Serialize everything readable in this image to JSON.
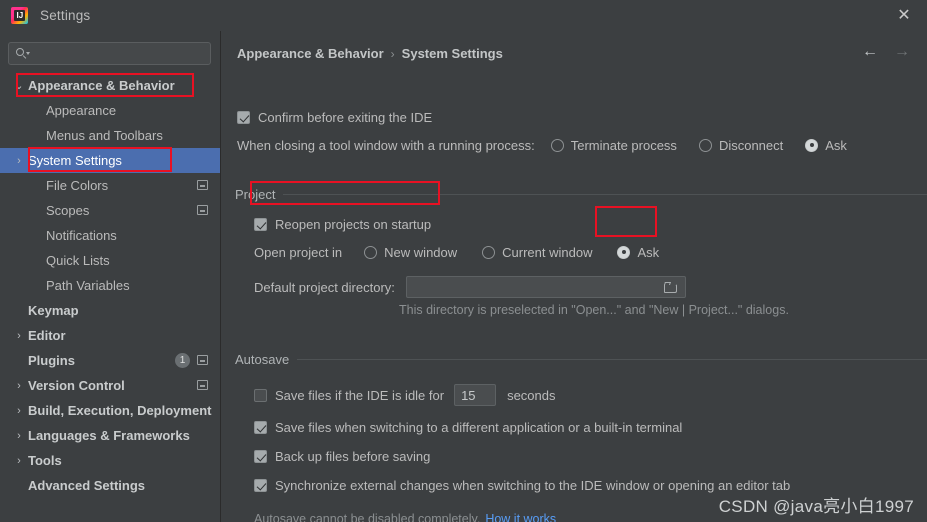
{
  "window": {
    "title": "Settings",
    "app_icon": "intellij-idea-icon",
    "close_label": "✕"
  },
  "sidebar": {
    "search": {
      "placeholder": "",
      "value": "",
      "icon": "search-icon"
    },
    "items": [
      {
        "label": "Appearance & Behavior",
        "indent": 1,
        "arrow": "⌄",
        "bold": true,
        "selected": false,
        "badge": "",
        "right_icon": false
      },
      {
        "label": "Appearance",
        "indent": 2,
        "arrow": "",
        "bold": false,
        "selected": false,
        "badge": "",
        "right_icon": false
      },
      {
        "label": "Menus and Toolbars",
        "indent": 2,
        "arrow": "",
        "bold": false,
        "selected": false,
        "badge": "",
        "right_icon": false
      },
      {
        "label": "System Settings",
        "indent": 1,
        "arrow": "›",
        "bold": false,
        "selected": true,
        "badge": "",
        "right_icon": false
      },
      {
        "label": "File Colors",
        "indent": 2,
        "arrow": "",
        "bold": false,
        "selected": false,
        "badge": "",
        "right_icon": true
      },
      {
        "label": "Scopes",
        "indent": 2,
        "arrow": "",
        "bold": false,
        "selected": false,
        "badge": "",
        "right_icon": true
      },
      {
        "label": "Notifications",
        "indent": 2,
        "arrow": "",
        "bold": false,
        "selected": false,
        "badge": "",
        "right_icon": false
      },
      {
        "label": "Quick Lists",
        "indent": 2,
        "arrow": "",
        "bold": false,
        "selected": false,
        "badge": "",
        "right_icon": false
      },
      {
        "label": "Path Variables",
        "indent": 2,
        "arrow": "",
        "bold": false,
        "selected": false,
        "badge": "",
        "right_icon": false
      },
      {
        "label": "Keymap",
        "indent": 1,
        "arrow": "",
        "bold": true,
        "selected": false,
        "badge": "",
        "right_icon": false
      },
      {
        "label": "Editor",
        "indent": 1,
        "arrow": "›",
        "bold": true,
        "selected": false,
        "badge": "",
        "right_icon": false
      },
      {
        "label": "Plugins",
        "indent": 1,
        "arrow": "",
        "bold": true,
        "selected": false,
        "badge": "1",
        "right_icon": true
      },
      {
        "label": "Version Control",
        "indent": 1,
        "arrow": "›",
        "bold": true,
        "selected": false,
        "badge": "",
        "right_icon": true
      },
      {
        "label": "Build, Execution, Deployment",
        "indent": 1,
        "arrow": "›",
        "bold": true,
        "selected": false,
        "badge": "",
        "right_icon": false
      },
      {
        "label": "Languages & Frameworks",
        "indent": 1,
        "arrow": "›",
        "bold": true,
        "selected": false,
        "badge": "",
        "right_icon": false
      },
      {
        "label": "Tools",
        "indent": 1,
        "arrow": "›",
        "bold": true,
        "selected": false,
        "badge": "",
        "right_icon": false
      },
      {
        "label": "Advanced Settings",
        "indent": 1,
        "arrow": "",
        "bold": true,
        "selected": false,
        "badge": "",
        "right_icon": false
      }
    ]
  },
  "main": {
    "breadcrumb": {
      "parent": "Appearance & Behavior",
      "separator": "›",
      "current": "System Settings"
    },
    "nav": {
      "back": "←",
      "forward": "→"
    },
    "confirm_exit": {
      "label": "Confirm before exiting the IDE",
      "checked": true
    },
    "closing_tool_window": {
      "label": "When closing a tool window with a running process:",
      "options": [
        {
          "label": "Terminate process",
          "selected": false
        },
        {
          "label": "Disconnect",
          "selected": false
        },
        {
          "label": "Ask",
          "selected": true
        }
      ]
    },
    "project_group": {
      "title": "Project",
      "reopen": {
        "label": "Reopen projects on startup",
        "checked": true
      },
      "open_project_in": {
        "label": "Open project in",
        "options": [
          {
            "label": "New window",
            "selected": false
          },
          {
            "label": "Current window",
            "selected": false
          },
          {
            "label": "Ask",
            "selected": true
          }
        ]
      },
      "default_dir": {
        "label": "Default project directory:",
        "value": "",
        "icon": "folder-icon",
        "hint": "This directory is preselected in \"Open...\" and \"New | Project...\" dialogs."
      }
    },
    "autosave_group": {
      "title": "Autosave",
      "idle": {
        "label": "Save files if the IDE is idle for",
        "checked": false,
        "seconds_value": "15",
        "unit_label": "seconds"
      },
      "checkboxes": [
        {
          "label": "Save files when switching to a different application or a built-in terminal",
          "checked": true
        },
        {
          "label": "Back up files before saving",
          "checked": true
        },
        {
          "label": "Synchronize external changes when switching to the IDE window or opening an editor tab",
          "checked": true
        }
      ],
      "footnote": {
        "text": "Autosave cannot be disabled completely.",
        "link": "How it works"
      }
    }
  },
  "annotations": {
    "highlight_color": "#e81123",
    "boxes": [
      "appearance-and-behavior-highlight",
      "system-settings-highlight",
      "reopen-projects-highlight",
      "open-project-ask-highlight"
    ]
  },
  "watermark": {
    "text": "CSDN @java亮小白1997"
  }
}
